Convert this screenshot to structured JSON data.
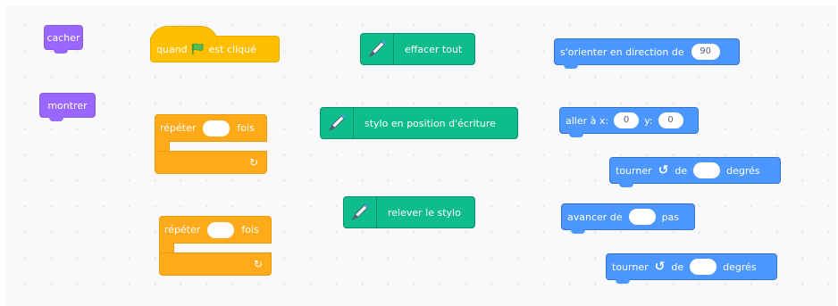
{
  "looks": {
    "hide_label": "cacher",
    "show_label": "montrer"
  },
  "events": {
    "flag_prefix": "quand",
    "flag_suffix": "est cliqué"
  },
  "control": {
    "repeat_1": {
      "prefix": "répéter",
      "suffix": "fois",
      "value": ""
    },
    "repeat_2": {
      "prefix": "répéter",
      "suffix": "fois",
      "value": ""
    }
  },
  "pen": {
    "erase_all_label": "effacer tout",
    "pen_down_label": "stylo en position d'écriture",
    "pen_up_label": "relever le stylo"
  },
  "motion": {
    "point_direction": {
      "label": "s'orienter en direction de",
      "value": "90"
    },
    "goto_xy": {
      "label": "aller à x:",
      "x": "0",
      "ylabel": "y:",
      "y": "0"
    },
    "turn_1": {
      "prefix": "tourner",
      "of": "de",
      "suffix": "degrés",
      "value": ""
    },
    "move": {
      "prefix": "avancer de",
      "suffix": "pas",
      "value": ""
    },
    "turn_2": {
      "prefix": "tourner",
      "of": "de",
      "suffix": "degrés",
      "value": ""
    }
  },
  "colors": {
    "looks": "#9966ff",
    "events": "#ffbf00",
    "control": "#ffab19",
    "pen": "#0fbd8c",
    "motion": "#4c97ff"
  }
}
